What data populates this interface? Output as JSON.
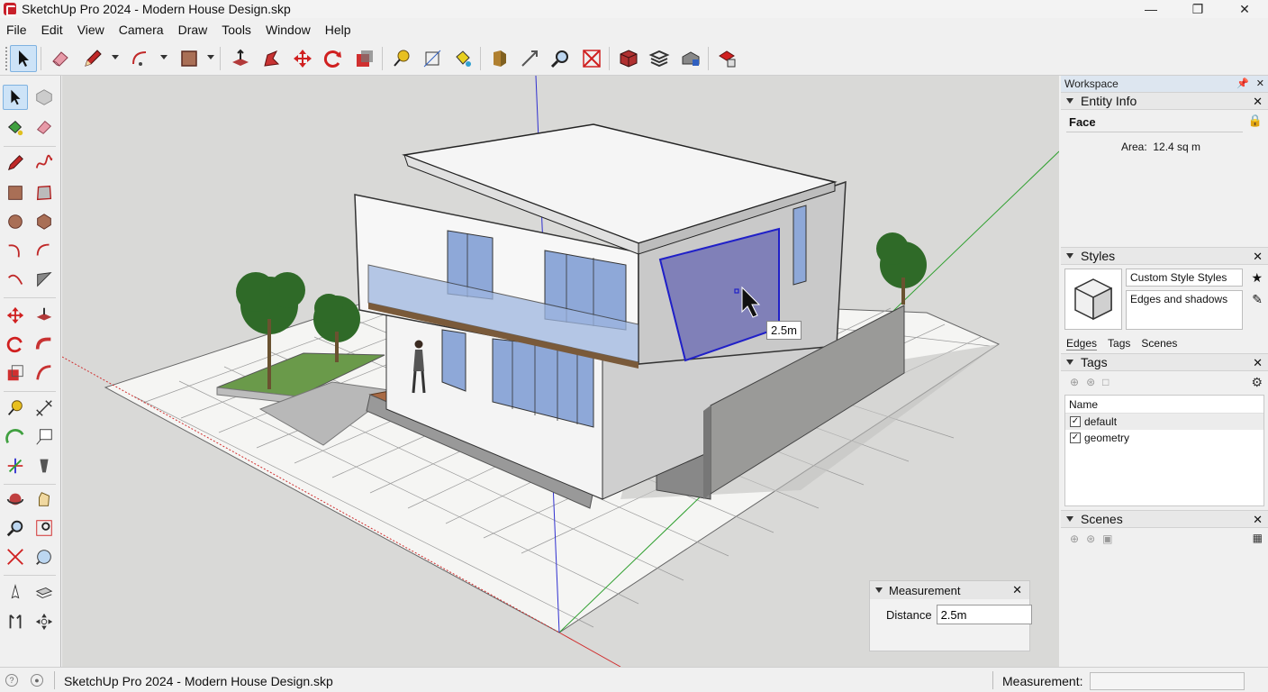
{
  "window": {
    "title": "SketchUp Pro 2024 - Modern House Design.skp",
    "controls": [
      "minimize",
      "maximize",
      "close"
    ]
  },
  "menu": [
    "File",
    "Edit",
    "View",
    "Camera",
    "Draw",
    "Tools",
    "Window",
    "Help"
  ],
  "toolbar_icons": [
    "select-icon",
    "eraser-icon",
    "pencil-icon",
    "arc-icon",
    "rectangle-icon",
    "push-pull-icon",
    "follow-me-icon",
    "move-icon",
    "rotate-icon",
    "offset-icon",
    "tape-measure-icon",
    "dimension-icon",
    "paint-bucket-icon",
    "orbit-icon",
    "pan-icon",
    "zoom-icon",
    "zoom-extents-icon",
    "component-icon",
    "tags-icon",
    "warehouse-icon",
    "extension-warehouse-icon"
  ],
  "viewport": {
    "tooltip": "2.5m"
  },
  "measurement_dialog": {
    "title": "Measurement",
    "label": "Distance",
    "value": "2.5m"
  },
  "tray": {
    "title": "Workspace",
    "entity_info": {
      "title": "Entity Info",
      "type": "Face",
      "area_label": "Area:",
      "area_value": "12.4 sq m"
    },
    "styles": {
      "title": "Styles",
      "name": "Custom Style Styles",
      "description": "Edges and shadows"
    },
    "subtabs": [
      "Edges",
      "Tags",
      "Scenes"
    ],
    "tags": {
      "title": "Tags",
      "column": "Name",
      "rows": [
        {
          "name": "default",
          "checked": true
        },
        {
          "name": "geometry",
          "checked": true
        }
      ]
    },
    "scenes": {
      "title": "Scenes"
    }
  },
  "statusbar": {
    "text": "SketchUp Pro 2024 - Modern House Design.skp",
    "measurement_label": "Measurement:"
  },
  "colors": {
    "selection": "#2020c8",
    "selected_face": "#8080b8",
    "x_axis": "#d03030",
    "y_axis": "#30a030",
    "z_axis": "#3030d0",
    "deck": "#a86a44",
    "glass": "#8ea8d8"
  }
}
